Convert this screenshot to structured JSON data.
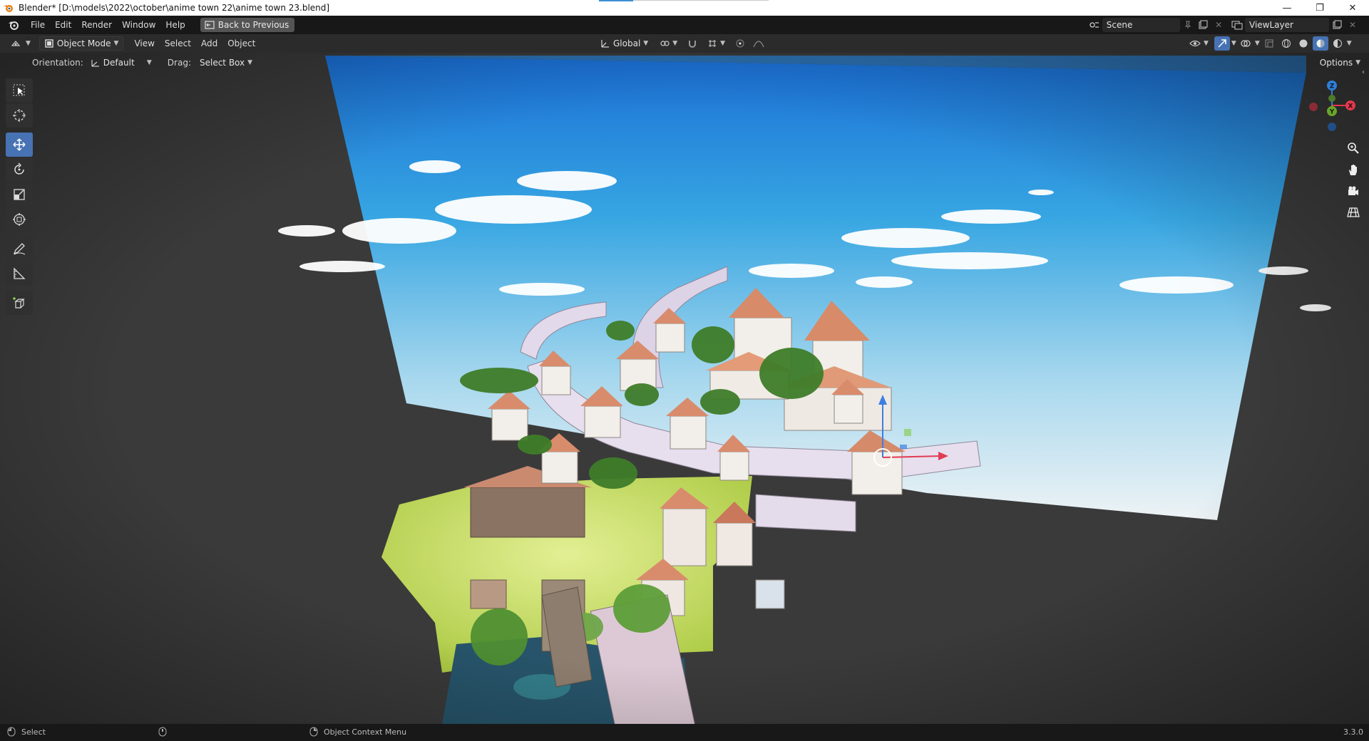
{
  "window": {
    "title": "Blender* [D:\\models\\2022\\october\\anime town 22\\anime town 23.blend]",
    "controls": [
      "minimize",
      "restore",
      "close"
    ]
  },
  "topbar": {
    "menus": [
      "File",
      "Edit",
      "Render",
      "Window",
      "Help"
    ],
    "back_button": "Back to Previous",
    "scene_name": "Scene",
    "view_layer": "ViewLayer"
  },
  "viewport_header": {
    "mode": "Object Mode",
    "menus": [
      "View",
      "Select",
      "Add",
      "Object"
    ],
    "transform_orientation": "Global"
  },
  "tool_settings": {
    "orientation_label": "Orientation:",
    "orientation_value": "Default",
    "drag_label": "Drag:",
    "drag_value": "Select Box",
    "options_label": "Options"
  },
  "toolbar": {
    "tools": [
      "select-box",
      "cursor",
      "move",
      "rotate",
      "scale",
      "transform",
      "annotate",
      "measure",
      "add-cube"
    ],
    "active_tool": "move"
  },
  "navigation_gizmo": {
    "axes": [
      {
        "label": "Z",
        "color": "#2f7fd6"
      },
      {
        "label": "X",
        "color": "#e0394d"
      },
      {
        "label": "Y",
        "color": "#6aa52b"
      }
    ]
  },
  "statusbar": {
    "left_action": "Select",
    "right_action": "Object Context Menu",
    "version": "3.3.0"
  },
  "colors": {
    "accent": "#4772b3",
    "sky_top": "#1a72d8",
    "sky_bottom": "#e6eef3",
    "grass": "#b3d048",
    "roof": "#d99070",
    "wall": "#f1ece7"
  }
}
